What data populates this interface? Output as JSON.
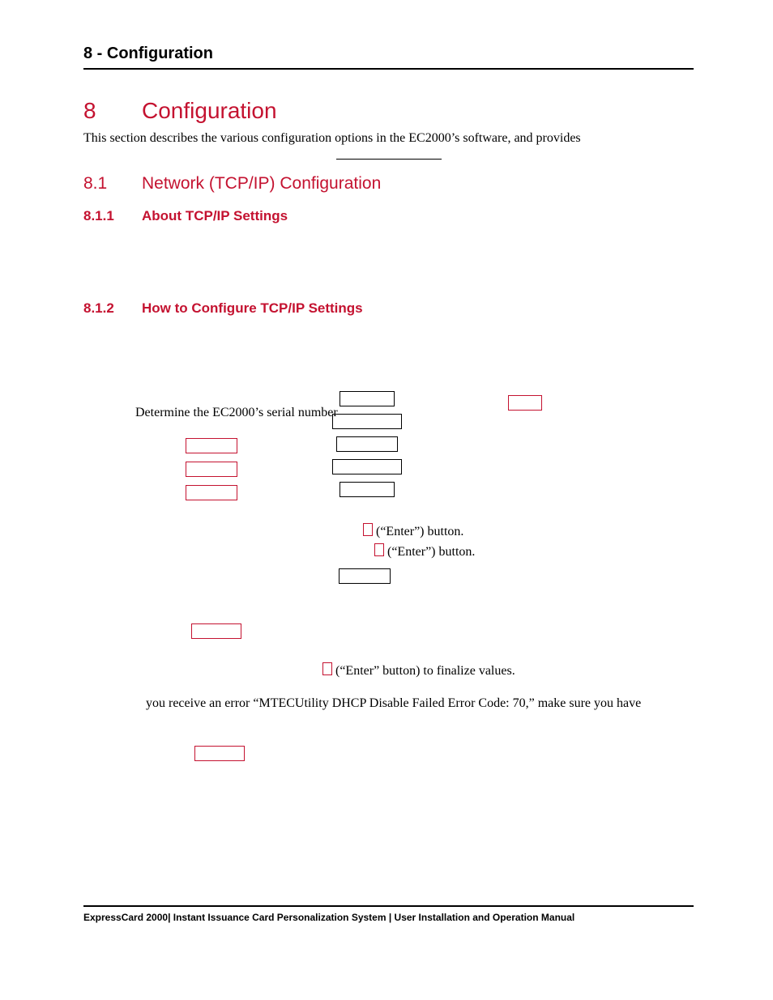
{
  "running_header": "8 - Configuration",
  "h1": {
    "number": "8",
    "title": "Configuration"
  },
  "intro": "This section describes the various configuration options in the EC2000’s software, and provides",
  "h2": {
    "number": "8.1",
    "title": "Network (TCP/IP) Configuration"
  },
  "h3a": {
    "number": "8.1.1",
    "title": "About TCP/IP Settings"
  },
  "h3b": {
    "number": "8.1.2",
    "title": "How to Configure TCP/IP Settings"
  },
  "step_determine": "Determine the EC2000’s serial number",
  "enter_label_1": "(“Enter”) button.",
  "enter_label_2": "(“Enter”) button.",
  "finalize": "(“Enter” button) to finalize values.",
  "error_line": "you receive an error “MTECUtility DHCP Disable Failed Error Code: 70,” make sure you have",
  "footer": "ExpressCard 2000| Instant Issuance Card Personalization System | User Installation and Operation Manual"
}
